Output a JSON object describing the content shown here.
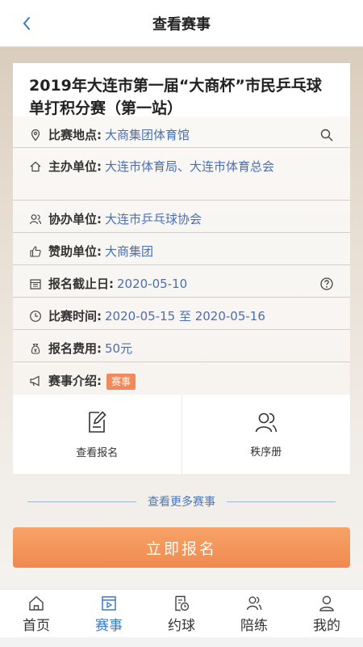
{
  "header": {
    "title": "查看赛事",
    "back_icon": "chevron-left-icon"
  },
  "event": {
    "title": "2019年大连市第一届“大商杯”市民乒乓球单打积分赛（第一站）"
  },
  "details": {
    "venue_label": "比赛地点:",
    "venue_value": "大商集团体育馆",
    "host_label": "主办单位:",
    "host_value": "大连市体育局、大连市体育总会",
    "co_label": "协办单位:",
    "co_value": "大连市乒乓球协会",
    "sponsor_label": "赞助单位:",
    "sponsor_value": "大商集团",
    "deadline_label": "报名截止日:",
    "deadline_value": "2020-05-10",
    "time_label": "比赛时间:",
    "time_value": "2020-05-15 至 2020-05-16",
    "fee_label": "报名费用:",
    "fee_value": "50元",
    "intro_label": "赛事介绍:",
    "intro_tag": "赛事"
  },
  "actions": {
    "view_signup": "查看报名",
    "order_book": "秩序册"
  },
  "more_events": "查看更多赛事",
  "signup_button": "立即报名",
  "tabs": [
    {
      "label": "首页",
      "icon": "home-icon",
      "active": false
    },
    {
      "label": "赛事",
      "icon": "event-icon",
      "active": true
    },
    {
      "label": "约球",
      "icon": "appointment-icon",
      "active": false
    },
    {
      "label": "陪练",
      "icon": "coach-icon",
      "active": false
    },
    {
      "label": "我的",
      "icon": "profile-icon",
      "active": false
    }
  ],
  "colors": {
    "accent": "#3a78c9",
    "orange": "#f08a4f",
    "link": "#4a6fb5"
  }
}
